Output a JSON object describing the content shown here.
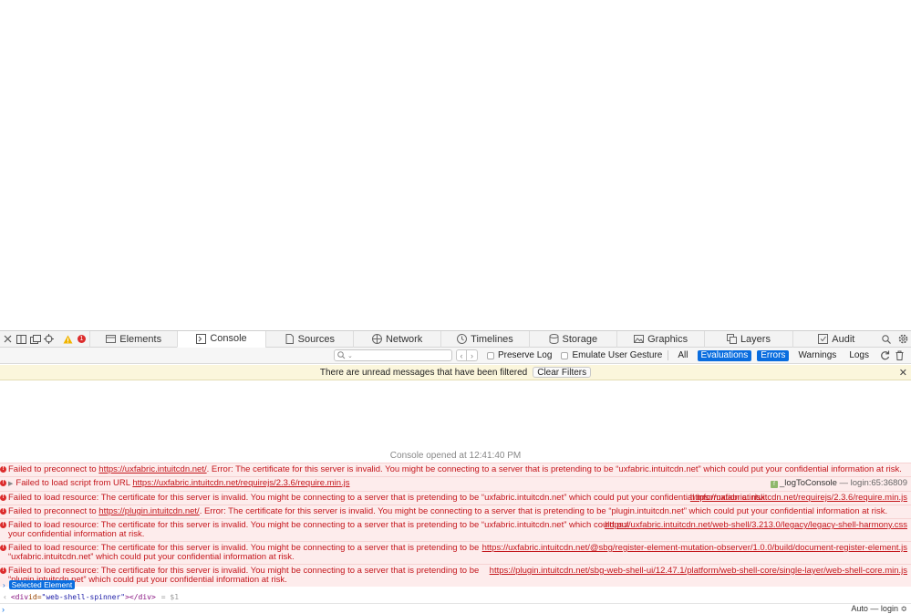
{
  "tabs": [
    {
      "label": "Elements",
      "icon": "elements-icon"
    },
    {
      "label": "Console",
      "icon": "console-icon"
    },
    {
      "label": "Sources",
      "icon": "sources-icon"
    },
    {
      "label": "Network",
      "icon": "network-icon"
    },
    {
      "label": "Timelines",
      "icon": "timelines-icon"
    },
    {
      "label": "Storage",
      "icon": "storage-icon"
    },
    {
      "label": "Graphics",
      "icon": "graphics-icon"
    },
    {
      "label": "Layers",
      "icon": "layers-icon"
    },
    {
      "label": "Audit",
      "icon": "audit-icon"
    }
  ],
  "active_tab": "Console",
  "error_count": "1",
  "filter": {
    "search_placeholder": "",
    "preserve_log": "Preserve Log",
    "emulate_gesture": "Emulate User Gesture",
    "all": "All",
    "evaluations": "Evaluations",
    "errors": "Errors",
    "warnings": "Warnings",
    "logs": "Logs"
  },
  "notice": {
    "text": "There are unread messages that have been filtered",
    "button": "Clear Filters"
  },
  "console_opened": "Console opened at 12:41:40 PM",
  "messages": [
    {
      "pre": "Failed to preconnect to ",
      "link": "https://uxfabric.intuitcdn.net/",
      "post": ". Error: The certificate for this server is invalid. You might be connecting to a server that is pretending to be “uxfabric.intuitcdn.net” which could put your confidential information at risk.",
      "src": ""
    },
    {
      "pre": "Failed to load script from URL ",
      "link": "https://uxfabric.intuitcdn.net/requirejs/2.3.6/require.min.js",
      "post": "",
      "fn": "_logToConsole",
      "loc": "login:65:36809"
    },
    {
      "pre": "Failed to load resource: The certificate for this server is invalid. You might be connecting to a server that is pretending to be “uxfabric.intuitcdn.net” which could put your confidential information at risk.",
      "link": "",
      "post": "",
      "src": "https://uxfabric.intuitcdn.net/requirejs/2.3.6/require.min.js"
    },
    {
      "pre": "Failed to preconnect to ",
      "link": "https://plugin.intuitcdn.net/",
      "post": ". Error: The certificate for this server is invalid. You might be connecting to a server that is pretending to be “plugin.intuitcdn.net” which could put your confidential information at risk.",
      "src": ""
    },
    {
      "pre": "Failed to load resource: The certificate for this server is invalid. You might be connecting to a server that is pretending to be “uxfabric.intuitcdn.net” which could put your confidential information at risk.",
      "link": "",
      "post": "",
      "src": "https://uxfabric.intuitcdn.net/web-shell/3.213.0/legacy/legacy-shell-harmony.css"
    },
    {
      "pre": "Failed to load resource: The certificate for this server is invalid. You might be connecting to a server that is pretending to be “uxfabric.intuitcdn.net” which could put your confidential information at risk.",
      "link": "",
      "post": "",
      "src": "https://uxfabric.intuitcdn.net/@sbg/register-element-mutation-observer/1.0.0/build/document-register-element.js"
    },
    {
      "pre": "Failed to load resource: The certificate for this server is invalid. You might be connecting to a server that is pretending to be “plugin.intuitcdn.net” which could put your confidential information at risk.",
      "link": "",
      "post": "",
      "src": "https://plugin.intuitcdn.net/sbg-web-shell-ui/12.47.1/platform/web-shell-core/single-layer/web-shell-core.min.js"
    }
  ],
  "selected_element": "Selected Element",
  "code": {
    "open": "<div ",
    "attr": "id=",
    "val": "\"web-shell-spinner\"",
    "close": "></div>",
    "ref": "= $1"
  },
  "prompt_context": "Auto — login ≎"
}
